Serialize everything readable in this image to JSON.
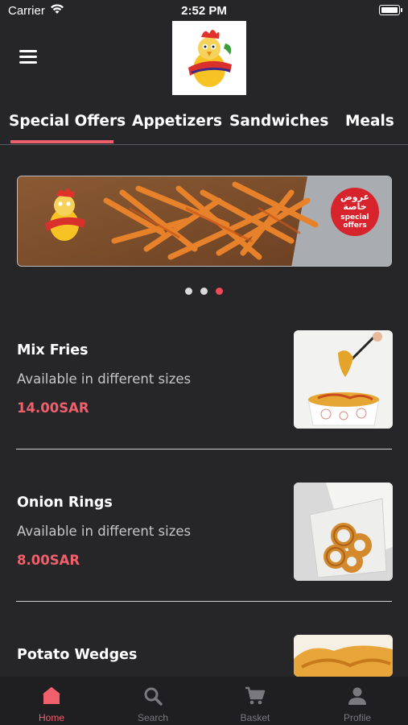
{
  "status_bar": {
    "carrier": "Carrier",
    "time": "2:52 PM"
  },
  "header": {
    "logo_text_top": "Spicy Mix",
    "logo_text_arabic": "سبايسي ميكس"
  },
  "tabs": [
    {
      "label": "Special Offers",
      "active": true
    },
    {
      "label": "Appetizers"
    },
    {
      "label": "Sandwiches"
    },
    {
      "label": "Meals"
    }
  ],
  "banner": {
    "badge_arabic": "عروض خاصة",
    "badge_text": "special offers",
    "page_count": 3,
    "active_page": 3
  },
  "items": [
    {
      "name": "Mix Fries",
      "desc": "Available in different sizes",
      "price": "14.00SAR"
    },
    {
      "name": "Onion Rings",
      "desc": "Available in different sizes",
      "price": "8.00SAR"
    },
    {
      "name": "Potato Wedges",
      "desc": "",
      "price": ""
    }
  ],
  "bottom_nav": [
    {
      "label": "Home",
      "icon": "home-icon",
      "active": true
    },
    {
      "label": "Search",
      "icon": "search-icon"
    },
    {
      "label": "Basket",
      "icon": "cart-icon"
    },
    {
      "label": "Profile",
      "icon": "profile-icon"
    }
  ],
  "colors": {
    "background": "#262629",
    "accent": "#f0606c",
    "nav_background": "#1f1f21"
  }
}
